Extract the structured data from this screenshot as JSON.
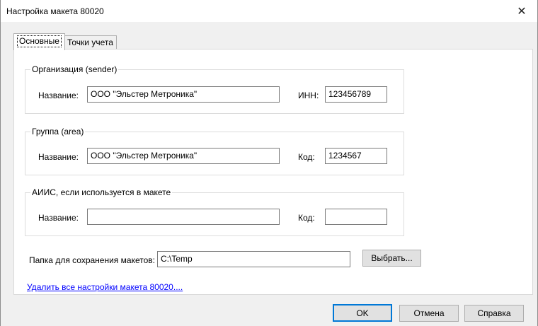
{
  "window": {
    "title": "Настройка макета 80020",
    "close_glyph": "✕"
  },
  "tabs": [
    {
      "label": "Основные"
    },
    {
      "label": "Точки учета"
    }
  ],
  "sender": {
    "legend": "Организация (sender)",
    "name_label": "Название:",
    "name_value": "ООО \"Эльстер Метроника\"",
    "inn_label": "ИНН:",
    "inn_value": "123456789"
  },
  "area": {
    "legend": "Группа (area)",
    "name_label": "Название:",
    "name_value": "ООО \"Эльстер Метроника\"",
    "code_label": "Код:",
    "code_value": "1234567"
  },
  "aiis": {
    "legend": "АИИС, если используется в макете",
    "name_label": "Название:",
    "name_value": "",
    "code_label": "Код:",
    "code_value": ""
  },
  "folder": {
    "label": "Папка для сохранения макетов:",
    "value": "C:\\Temp",
    "browse_label": "Выбрать..."
  },
  "delete_link": "Удалить все настройки макета 80020....",
  "buttons": {
    "ok": "OK",
    "cancel": "Отмена",
    "help": "Справка"
  }
}
